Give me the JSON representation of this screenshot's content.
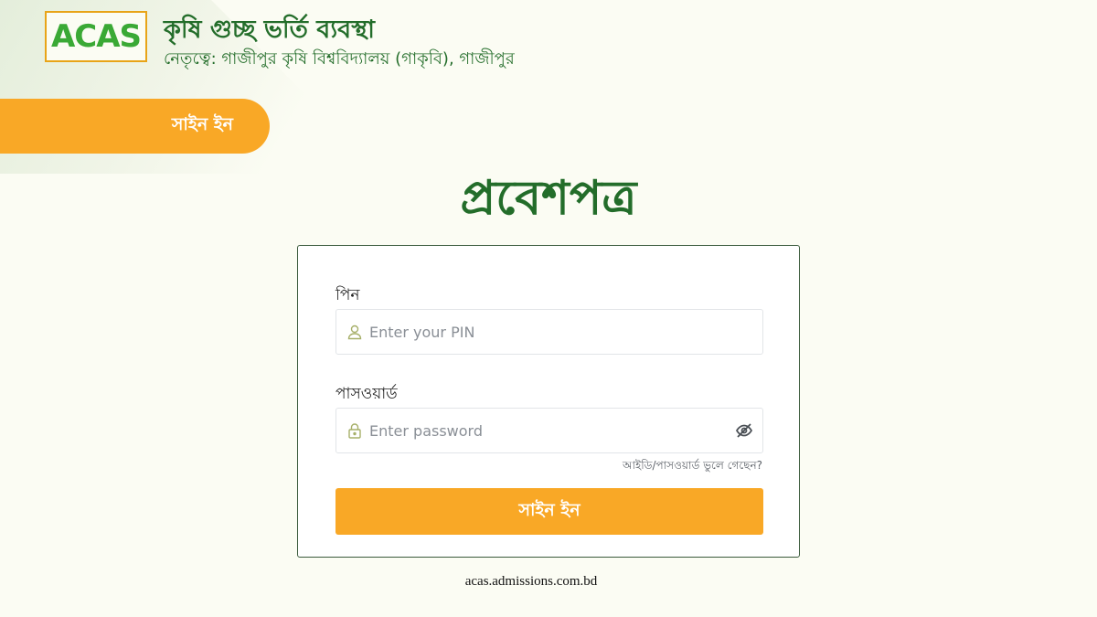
{
  "brand": {
    "logo_text": "ACAS",
    "title": "কৃষি গুচ্ছ ভর্তি ব্যবস্থা",
    "subtitle": "নেতৃত্বে: গাজীপুর কৃষি বিশ্ববিদ্যালয় (গাকৃবি), গাজীপুর"
  },
  "nav": {
    "signin_label": "সাইন ইন"
  },
  "page": {
    "heading": "প্রবেশপত্র"
  },
  "form": {
    "pin_label": "পিন",
    "pin_placeholder": "Enter your PIN",
    "pin_icon": "user-icon",
    "password_label": "পাসওয়ার্ড",
    "password_placeholder": "Enter password",
    "password_icon": "lock-icon",
    "toggle_icon": "eye-off-icon",
    "forgot_link": "আইডি/পাসওয়ার্ড ভুলে গেছেন?",
    "submit_label": "সাইন ইন"
  },
  "footer": {
    "watermark": "acas.admissions.com.bd"
  },
  "colors": {
    "brand_green": "#236d2a",
    "accent_orange": "#f9a826",
    "logo_green": "#3aa935"
  }
}
